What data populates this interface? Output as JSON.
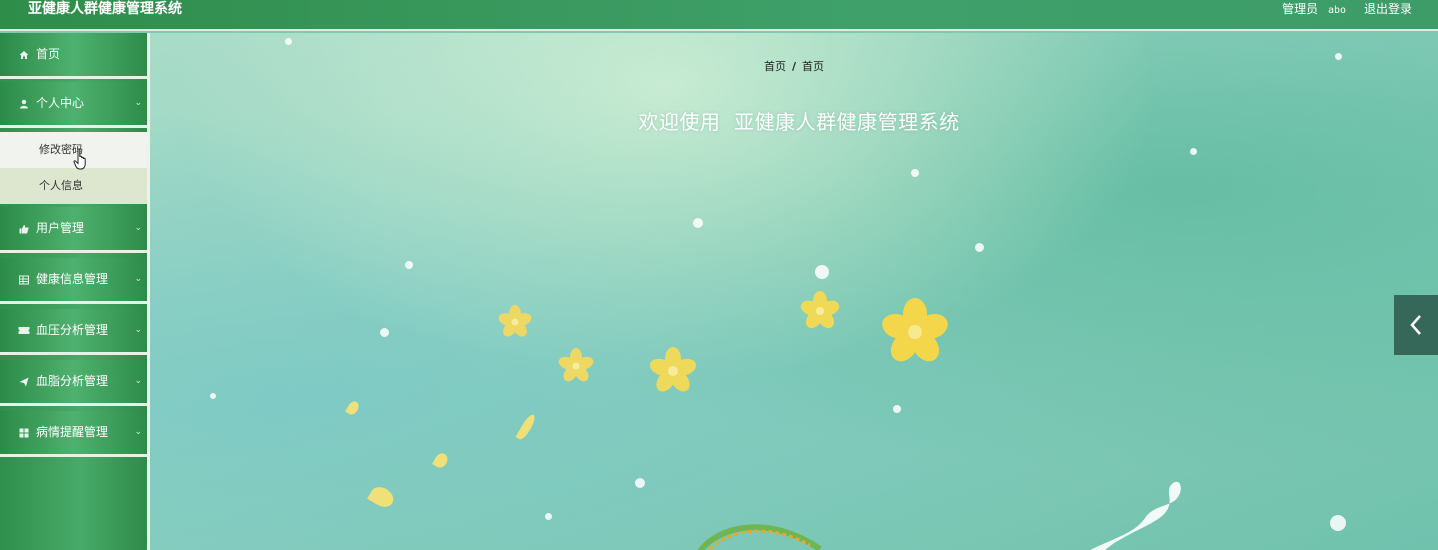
{
  "app": {
    "title": "亚健康人群健康管理系统"
  },
  "header": {
    "user_role": "管理员",
    "user_name": "abo",
    "logout_label": "退出登录"
  },
  "sidebar": {
    "items": [
      {
        "label": "首页",
        "icon": "home-icon"
      },
      {
        "label": "个人中心",
        "icon": "user-icon",
        "expanded": true,
        "children": [
          {
            "label": "修改密码",
            "hovered": true
          },
          {
            "label": "个人信息"
          }
        ]
      },
      {
        "label": "用户管理",
        "icon": "thumbs-up-icon"
      },
      {
        "label": "健康信息管理",
        "icon": "grid-table-icon"
      },
      {
        "label": "血压分析管理",
        "icon": "ticket-icon"
      },
      {
        "label": "血脂分析管理",
        "icon": "paper-plane-icon"
      },
      {
        "label": "病情提醒管理",
        "icon": "apps-grid-icon"
      }
    ]
  },
  "main": {
    "breadcrumb": [
      "首页",
      "首页"
    ],
    "breadcrumb_separator": "/",
    "welcome_text": "欢迎使用  亚健康人群健康管理系统"
  },
  "colors": {
    "header_green": "#3a9a5e",
    "sidebar_green": "#48aa68",
    "submenu_hover_bg": "#f1f3ef",
    "submenu_bg": "#dde6cf",
    "toggle_bg": "#36685a",
    "main_bg": "#8fd0bd"
  }
}
